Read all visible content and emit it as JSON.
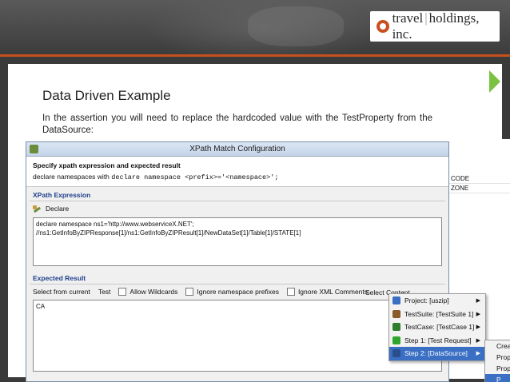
{
  "header": {
    "logo_brand": "travel",
    "logo_rest": "holdings, inc."
  },
  "slide": {
    "title": "Data Driven Example",
    "text": "In the assertion you will need to replace the hardcoded value with the TestProperty from the DataSource:"
  },
  "background_table": {
    "rows": [
      "CODE",
      "ZONE"
    ]
  },
  "dialog": {
    "title": "XPath Match Configuration",
    "header_title": "Specify xpath expression and expected result",
    "header_text_prefix": "declare namespaces with",
    "header_text_code": "declare namespace <prefix>='<namespace>';",
    "xpath_section": "XPath Expression",
    "declare_label": "Declare",
    "xpath_line1": "declare namespace ns1='http://www.webserviceX.NET';",
    "xpath_line2": "//ns1:GetInfoByZIPResponse[1]/ns1:GetInfoByZIPResult[1]/NewDataSet[1]/Table[1]/STATE[1]",
    "expected_section": "Expected Result",
    "select_from_current": "Select from current",
    "test_label": "Test",
    "allow_wildcards": "Allow Wildcards",
    "ignore_ns_prefixes": "Ignore namespace prefixes",
    "ignore_xml_comments": "Ignore XML Comments",
    "select_content": "Select Content",
    "expected_value": "CA"
  },
  "menu": {
    "items": [
      {
        "label": "Project: [uszip]",
        "icon_color": "#3a6fc4"
      },
      {
        "label": "TestSuite: [TestSuite 1]",
        "icon_color": "#8a5a2a"
      },
      {
        "label": "TestCase: [TestCase 1]",
        "icon_color": "#2f7d2f"
      },
      {
        "label": "Step 1: [Test Request]",
        "icon_color": "#2fa52f"
      },
      {
        "label": "Step 2: [DataSource]",
        "icon_color": "#3a6fc4"
      }
    ],
    "submenu": [
      "Crea",
      "Prop",
      "Prop",
      "P"
    ]
  }
}
